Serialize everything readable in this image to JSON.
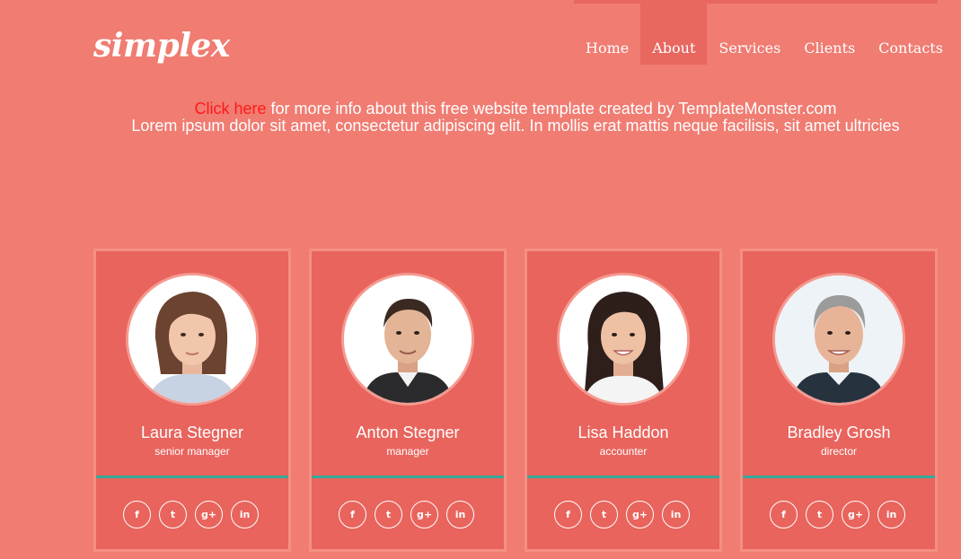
{
  "site": {
    "logo": "simplex"
  },
  "nav": {
    "items": [
      {
        "label": "Home"
      },
      {
        "label": "About"
      },
      {
        "label": "Services"
      },
      {
        "label": "Clients"
      },
      {
        "label": "Contacts"
      }
    ],
    "active": "About"
  },
  "promo": {
    "link_text": "Click here",
    "text_rest": " for more info about this free website template created by TemplateMonster.com",
    "line2": "Lorem ipsum dolor sit amet, consectetur adipiscing elit. In mollis erat mattis neque facilisis, sit amet ultricies"
  },
  "team": [
    {
      "name": "Laura Stegner",
      "role": "senior manager"
    },
    {
      "name": "Anton Stegner",
      "role": "manager"
    },
    {
      "name": "Lisa Haddon",
      "role": "accounter"
    },
    {
      "name": "Bradley Grosh",
      "role": "director"
    }
  ],
  "social_icons": [
    {
      "name": "facebook-icon",
      "glyph": "f"
    },
    {
      "name": "twitter-icon",
      "glyph": "t"
    },
    {
      "name": "google-plus-icon",
      "glyph": "g+"
    },
    {
      "name": "linkedin-icon",
      "glyph": "in"
    }
  ],
  "colors": {
    "background": "#f07c72",
    "card": "#e8645d",
    "card_border": "#f58f84",
    "divider": "#36a99a",
    "link": "#ff1a1a"
  }
}
